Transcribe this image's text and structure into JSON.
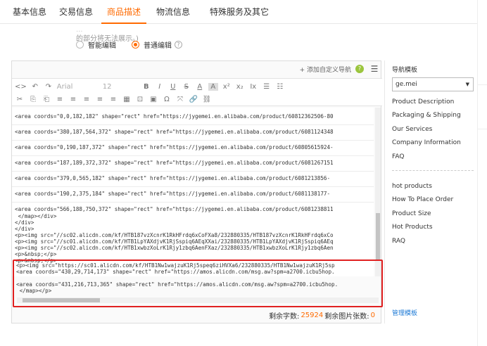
{
  "tabs": [
    "基本信息",
    "交易信息",
    "商品描述",
    "物流信息",
    "特殊服务及其它"
  ],
  "active_tab": "商品描述",
  "hint": {
    "line1": "...",
    "line2": "的部分将无法展示。)"
  },
  "editor_modes": {
    "smart": "智能编辑",
    "normal": "普通编辑"
  },
  "editor_top": {
    "add_nav": "+ 添加自定义导航",
    "help": "?",
    "menu": "☰"
  },
  "toolbar": {
    "font": "Arial",
    "size": "12",
    "row1": [
      "<>",
      "↶",
      "↷",
      "B",
      "I",
      "U",
      "S",
      "A",
      "A",
      "x²",
      "x₂",
      "Ix",
      "☰",
      "☷"
    ],
    "row2": [
      "✂",
      "⎘",
      "⎗",
      "≡",
      "≡",
      "≡",
      "≡",
      "≡",
      "▦",
      "⊡",
      "▣",
      "Ω",
      "⤧",
      "🔗",
      "⛓"
    ]
  },
  "code_lines": [
    "<area coords=\"0,0,182,182\" shape=\"rect\" href=\"https://jygemei.en.alibaba.com/product/60812362506-80",
    "<area coords=\"380,187,564,372\" shape=\"rect\" href=\"https://jygemei.en.alibaba.com/product/6081124348",
    "<area coords=\"0,190,187,372\" shape=\"rect\" href=\"https://jygemei.en.alibaba.com/product/60805615924-",
    "<area coords=\"187,189,372,372\" shape=\"rect\" href=\"https://jygemei.en.alibaba.com/product/6081267151",
    "<area coords=\"379,0,565,182\" shape=\"rect\" href=\"https://jygemei.en.alibaba.com/product/6081213856-",
    "<area coords=\"190,2,375,184\" shape=\"rect\" href=\"https://jygemei.en.alibaba.com/product/6081138177-",
    "<area coords=\"566,188,750,372\" shape=\"rect\" href=\"https://jygemei.en.alibaba.com/product/6081238811",
    " </map></div>",
    "</div>",
    "</div>",
    "<p><img src=\"//sc02.alicdn.com/kf/HTB187vzXcnrK1RkHFrdq6xCoFXa8/232880335/HTB187vzXcnrK1RkHFrdq6xCo",
    "<p><img src=\"//sc01.alicdn.com/kf/HTB1LpYAXdjvK1RjSspiq6AEqXXai/232880335/HTB1LpYAXdjvK1RjSspiq6AEq",
    "<p><img src=\"//sc02.alicdn.com/kf/HTB1xwbzXoLrK1Rjy1zbq6AenFXaz/232880335/HTB1xwbzXoLrK1Rjy1zbq6Aen",
    "<p>&nbsp;</p>",
    "<p>&nbsp;</p>",
    "<p><img src=\"https://sc01.alicdn.com/kf/HTB1Nw1wajzuK1Rj5speq6ziHVXa6/232880335/HTB1Nw1wajzuK1Rj5sp",
    "<area coords=\"430,29,714,173\" shape=\"rect\" href=\"https://amos.alicdn.com/msg.aw?spm=a2700.icbu5hop.",
    "<area coords=\"431,216,713,365\" shape=\"rect\" href=\"https://amos.alicdn.com/msg.aw?spm=a2700.icbu5hop.",
    " </map></p>"
  ],
  "counter": {
    "chars_label": "剩余字数:",
    "chars_value": "25924",
    "images_label": "剩余图片张数:",
    "images_value": "0"
  },
  "nav_panel": {
    "title": "导航模板",
    "selected": "ge.mei",
    "items": [
      "Product Description",
      "Packaging & Shipping",
      "Our Services",
      "Company Information",
      "FAQ"
    ],
    "items2": [
      "hot products",
      "How To Place Order",
      "Product Size",
      "Hot Products",
      "RAQ"
    ],
    "manage": "管理模板"
  },
  "colors": {
    "accent": "#ff6a00",
    "highlight": "#e02020",
    "link": "#1f7bd6"
  }
}
